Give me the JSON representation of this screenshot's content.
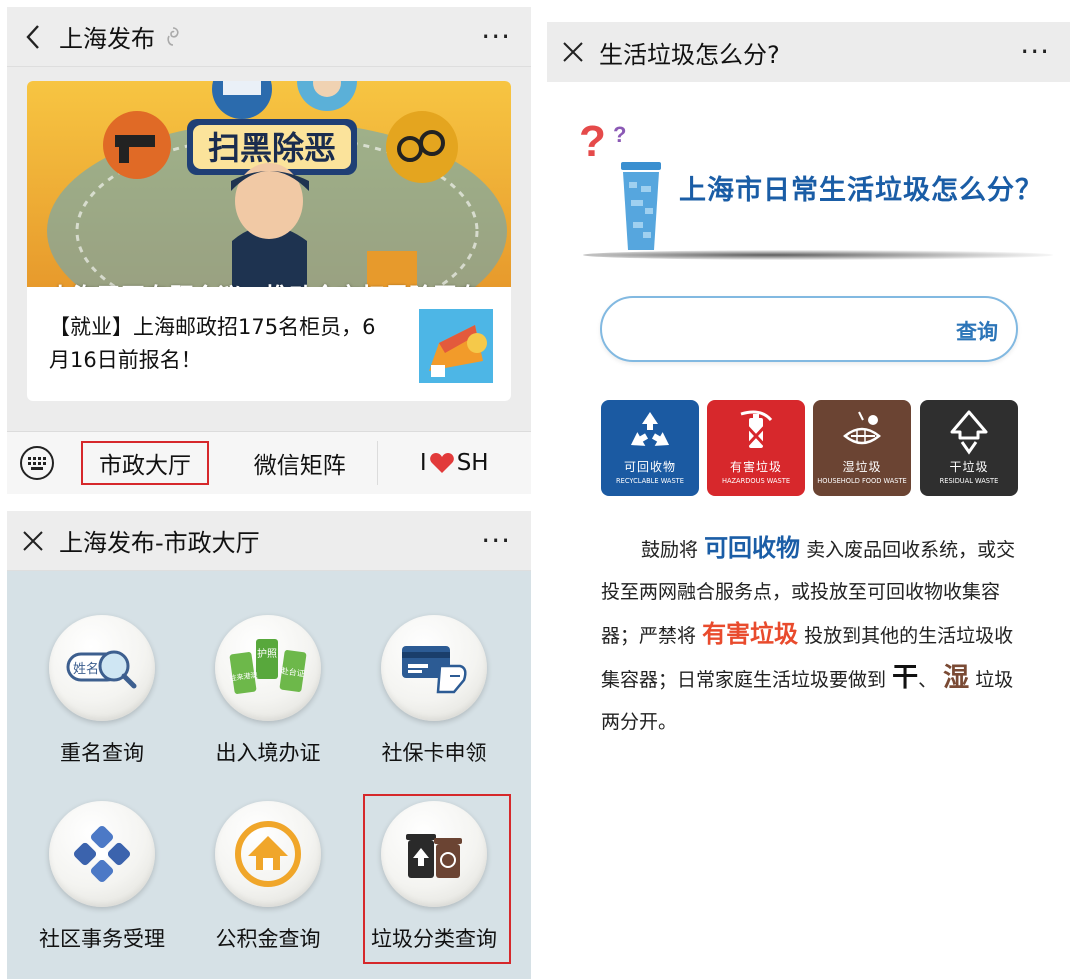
{
  "panel1": {
    "title": "上海发布",
    "hero_title": "上海召开专题会议，推动全市扫黑除恶专项斗争向纵深发展！",
    "hero_banner_text": "扫黑除恶",
    "news_item": "【就业】上海邮政招175名柜员，6月16日前报名！",
    "menu": [
      "市政大厅",
      "微信矩阵",
      "I",
      "SH"
    ]
  },
  "panel2": {
    "title": "上海发布-市政大厅",
    "services": [
      {
        "label": "重名查询",
        "icon": "name-search-icon",
        "icon_text": "姓名"
      },
      {
        "label": "出入境办证",
        "icon": "passport-icon",
        "icon_text": [
          "护照",
          "往来港澳",
          "赴台证"
        ]
      },
      {
        "label": "社保卡申领",
        "icon": "social-card-icon"
      },
      {
        "label": "社区事务受理",
        "icon": "community-icon"
      },
      {
        "label": "公积金查询",
        "icon": "housing-fund-icon"
      },
      {
        "label": "垃圾分类查询",
        "icon": "trash-sort-icon"
      }
    ]
  },
  "panel3": {
    "title": "生活垃圾怎么分?",
    "header_title": "上海市日常生活垃圾怎么分？",
    "search_input_value": "",
    "search_button": "查询",
    "bins": [
      {
        "cn": "可回收物",
        "en": "RECYCLABLE WASTE",
        "color": "#1b5aa2"
      },
      {
        "cn": "有害垃圾",
        "en": "HAZARDOUS WASTE",
        "color": "#d7282c"
      },
      {
        "cn": "湿垃圾",
        "en": "HOUSEHOLD FOOD WASTE",
        "color": "#6b4433"
      },
      {
        "cn": "干垃圾",
        "en": "RESIDUAL WASTE",
        "color": "#2f2f2f"
      }
    ],
    "desc": {
      "t1": "鼓励将",
      "k1": "可回收物",
      "t2": "卖入废品回收系统，或交投至两网融合服务点，或投放至可回收物收集容器；严禁将",
      "k2": "有害垃圾",
      "t3": "投放到其他的生活垃圾收集容器；日常家庭生活垃圾要做到",
      "k3": "干",
      "t4": "、",
      "k4": "湿",
      "t5": "垃圾两分开。"
    }
  },
  "colors": {
    "highlight_red": "#d6282b",
    "titlebar_bg": "#ededed",
    "hall_bg": "#d6e1e6",
    "brand_blue": "#1a5da6",
    "hazard_red": "#e94b2d"
  }
}
